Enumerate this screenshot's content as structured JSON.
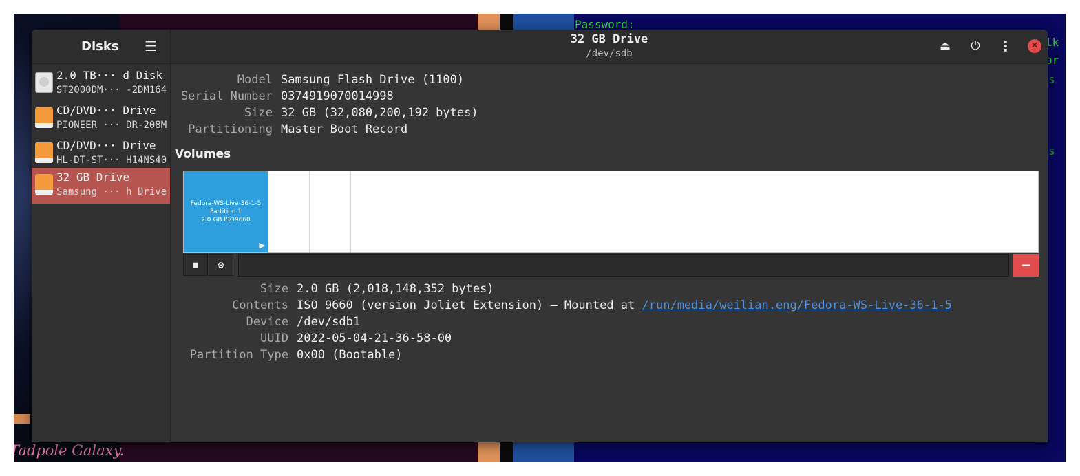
{
  "background": {
    "terminal_lines": [
      "Password:",
      "lk",
      "or",
      "s",
      "s"
    ],
    "wallpaper_caption": "Tadpole Galaxy."
  },
  "sidebar": {
    "title": "Disks",
    "menu_icon": "hamburger-menu-icon",
    "drives": [
      {
        "name": "2.0 TB··· d Disk",
        "sub": "ST2000DM··· -2DM164",
        "icon": "hard-disk-icon",
        "selected": false
      },
      {
        "name": "CD/DVD···  Drive",
        "sub": "PIONEER ··· DR-208M",
        "icon": "optical-drive-icon",
        "selected": false
      },
      {
        "name": "CD/DVD···  Drive",
        "sub": "HL-DT-ST··· H14NS40",
        "icon": "optical-drive-icon",
        "selected": false
      },
      {
        "name": "32 GB Drive",
        "sub": "Samsung ··· h Drive",
        "icon": "usb-drive-icon",
        "selected": true
      }
    ]
  },
  "header": {
    "title": "32 GB Drive",
    "subtitle": "/dev/sdb",
    "buttons": [
      "eject-icon",
      "power-icon",
      "more-options-icon",
      "close-icon"
    ]
  },
  "drive_props": [
    {
      "label": "Model",
      "value": "Samsung Flash Drive (1100)"
    },
    {
      "label": "Serial Number",
      "value": "0374919070014998"
    },
    {
      "label": "Size",
      "value": "32 GB (32,080,200,192 bytes)"
    },
    {
      "label": "Partitioning",
      "value": "Master Boot Record"
    }
  ],
  "volumes": {
    "heading": "Volumes",
    "partition": {
      "line1": "Fedora-WS-Live-36-1-5",
      "line2": "Partition 1",
      "line3": "2.0 GB ISO9660"
    },
    "toolbar": {
      "stop_icon": "stop-icon",
      "settings_icon": "gears-icon",
      "delete_icon": "minus-icon",
      "play_icon": "play-icon"
    }
  },
  "volume_props": {
    "size": {
      "label": "Size",
      "value": "2.0 GB (2,018,148,352 bytes)"
    },
    "contents": {
      "label": "Contents",
      "prefix": "ISO 9660 (version Joliet Extension) — Mounted at ",
      "link": "/run/media/weilian.eng/Fedora-WS-Live-36-1-5"
    },
    "device": {
      "label": "Device",
      "value": "/dev/sdb1"
    },
    "uuid": {
      "label": "UUID",
      "value": "2022-05-04-21-36-58-00"
    },
    "partition_type": {
      "label": "Partition Type",
      "value": "0x00 (Bootable)"
    }
  },
  "colors": {
    "selected_drive": "#b6544f",
    "partition_fill": "#2e9fdc",
    "delete_button": "#e24c4c",
    "link": "#4f8fdd",
    "terminal_text": "#2ddb3a"
  }
}
